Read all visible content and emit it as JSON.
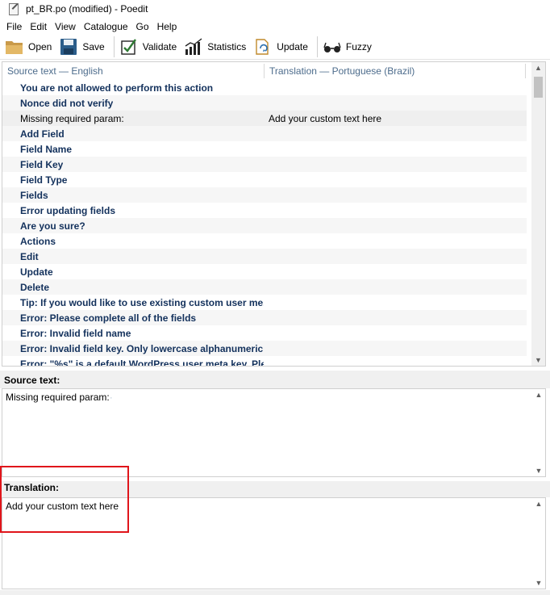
{
  "window": {
    "title": "pt_BR.po (modified) - Poedit"
  },
  "menubar": {
    "items": [
      "File",
      "Edit",
      "View",
      "Catalogue",
      "Go",
      "Help"
    ]
  },
  "toolbar": {
    "buttons": [
      {
        "label": "Open",
        "icon": "folder-icon"
      },
      {
        "label": "Save",
        "icon": "floppy-disk-icon"
      },
      {
        "label": "Validate",
        "icon": "checkmark-icon"
      },
      {
        "label": "Statistics",
        "icon": "bar-chart-icon"
      },
      {
        "label": "Update",
        "icon": "update-icon"
      },
      {
        "label": "Fuzzy",
        "icon": "glasses-icon"
      }
    ]
  },
  "list": {
    "header": {
      "source": "Source text — English",
      "translation": "Translation — Portuguese (Brazil)"
    },
    "rows": [
      {
        "source": "You are not allowed to perform this action",
        "translation": ""
      },
      {
        "source": "Nonce did not verify",
        "translation": ""
      },
      {
        "source": "Missing required param:",
        "translation": "Add your custom text here"
      },
      {
        "source": "Add Field",
        "translation": ""
      },
      {
        "source": "Field Name",
        "translation": ""
      },
      {
        "source": "Field Key",
        "translation": ""
      },
      {
        "source": "Field Type",
        "translation": ""
      },
      {
        "source": "Fields",
        "translation": ""
      },
      {
        "source": "Error updating fields",
        "translation": ""
      },
      {
        "source": "Are you sure?",
        "translation": ""
      },
      {
        "source": "Actions",
        "translation": ""
      },
      {
        "source": "Edit",
        "translation": ""
      },
      {
        "source": "Update",
        "translation": ""
      },
      {
        "source": "Delete",
        "translation": ""
      },
      {
        "source": "Tip: If you would like to use existing custom user me...",
        "translation": ""
      },
      {
        "source": "Error: Please complete all of the fields",
        "translation": ""
      },
      {
        "source": "Error: Invalid field name",
        "translation": ""
      },
      {
        "source": "Error: Invalid field key. Only lowercase alphanumeric...",
        "translation": ""
      },
      {
        "source": "Error: \"%s\" is a default WordPress user meta key. Ple...",
        "translation": ""
      }
    ],
    "selected_index": 2
  },
  "source_panel": {
    "label": "Source text:",
    "text": "Missing required param:"
  },
  "translation_panel": {
    "label": "Translation:",
    "text": "Add your custom text here"
  },
  "colors": {
    "source_text": "#13315c",
    "header_text": "#4d6c8c",
    "highlight": "#e0151b",
    "panel_bg": "#f0f0f0"
  }
}
